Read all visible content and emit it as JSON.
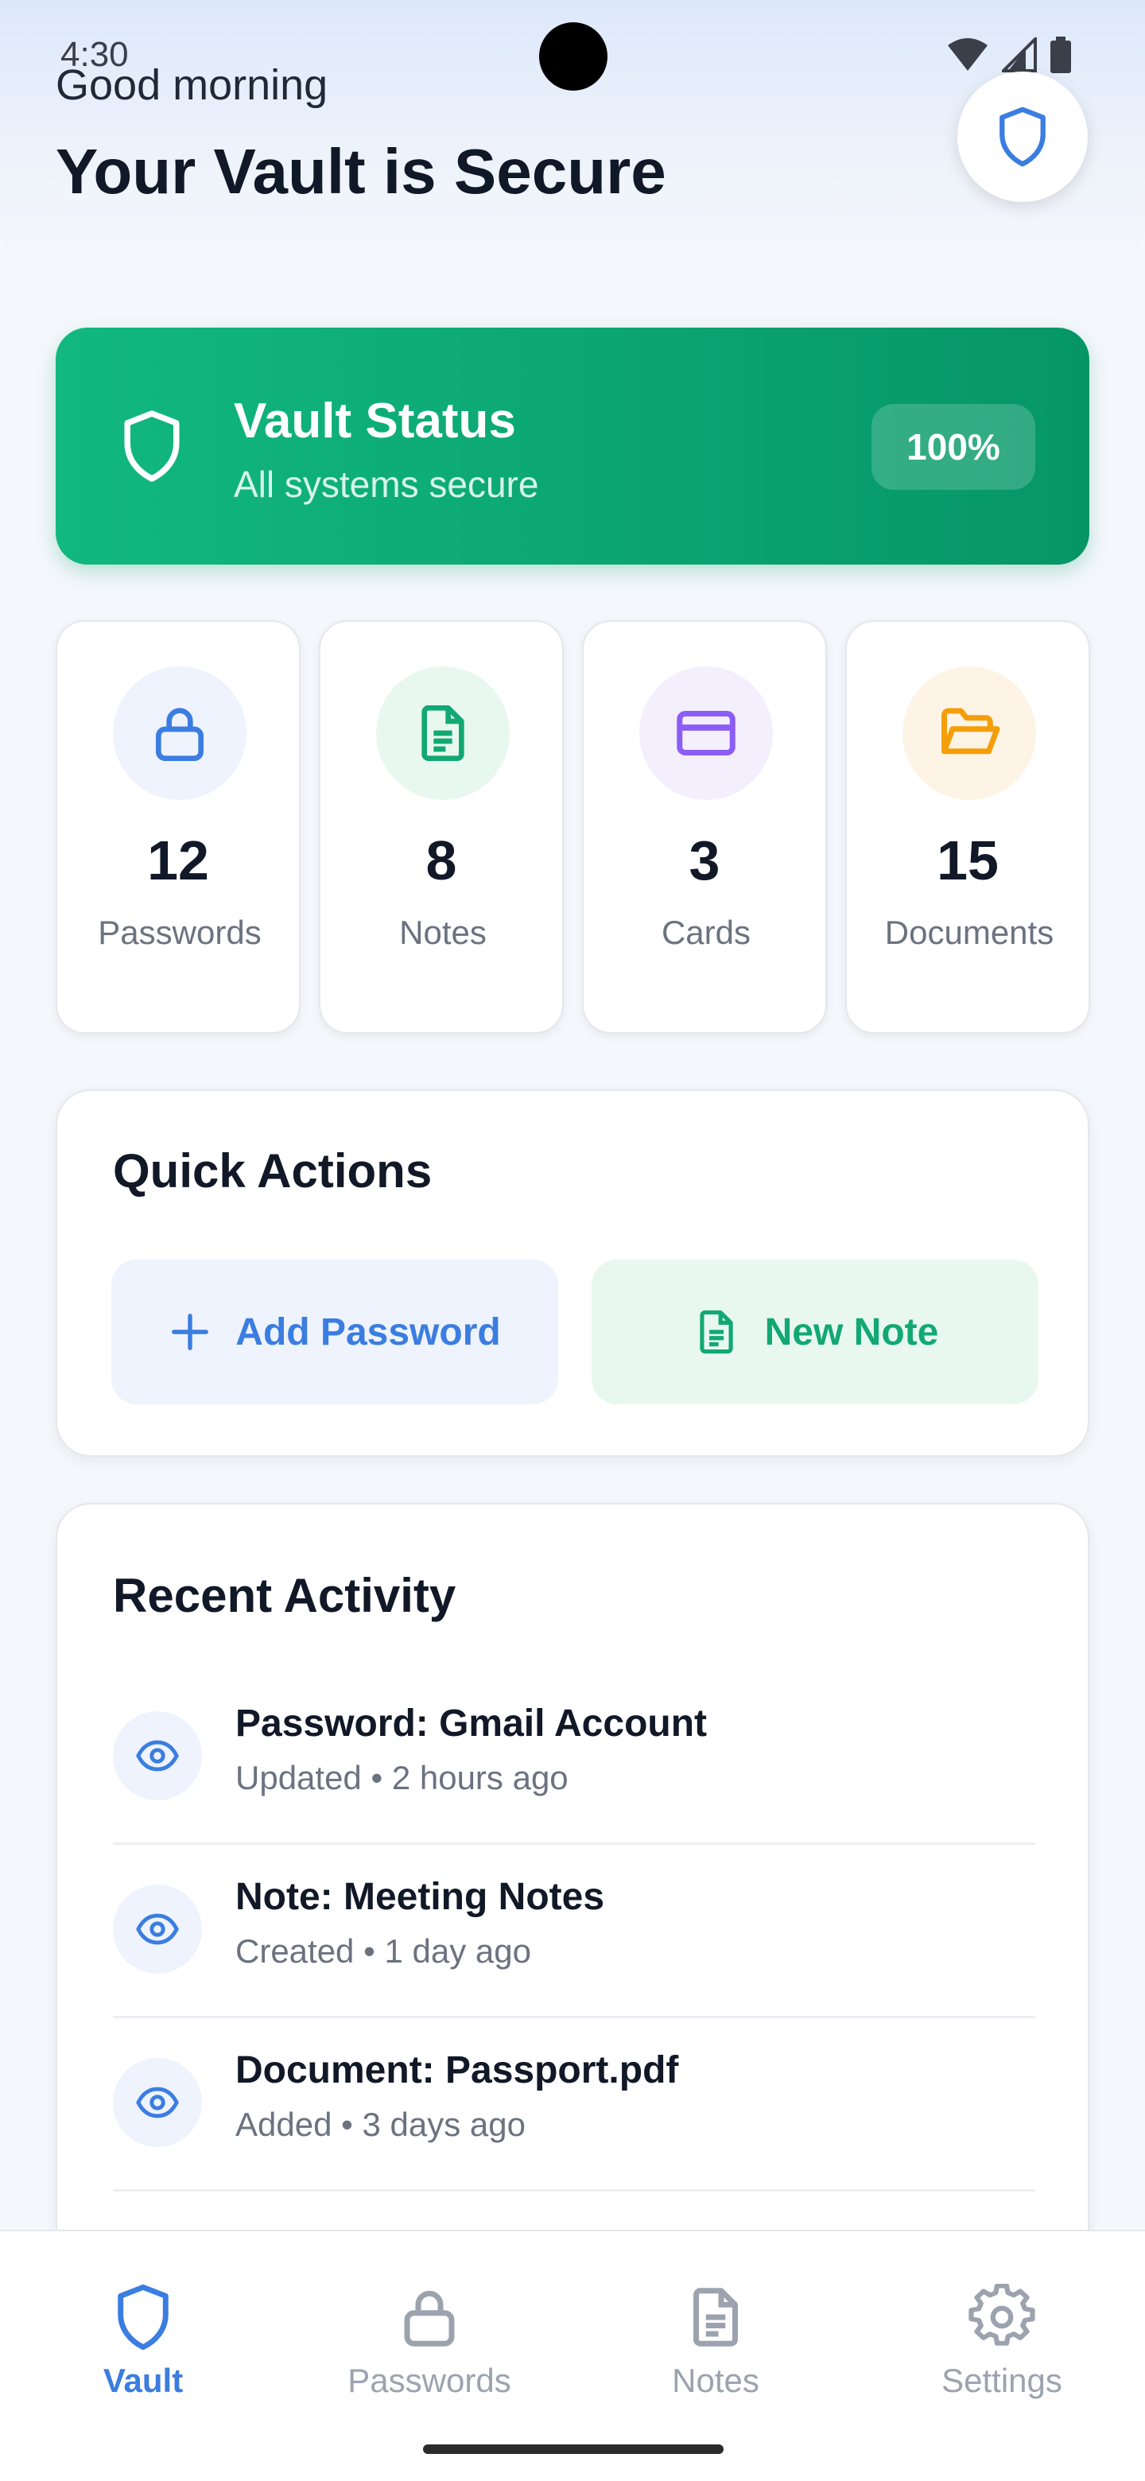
{
  "status_bar": {
    "time": "4:30"
  },
  "header": {
    "greeting": "Good morning",
    "title": "Your Vault is Secure",
    "shield_icon": "shield-icon"
  },
  "vault_status": {
    "title": "Vault Status",
    "subtitle": "All systems secure",
    "percent": "100%",
    "color": "#10b37d"
  },
  "stats": [
    {
      "count": "12",
      "label": "Passwords",
      "icon": "lock-icon",
      "color": "#3b7de0",
      "bg": "#eef3fd"
    },
    {
      "count": "8",
      "label": "Notes",
      "icon": "document-icon",
      "color": "#12a875",
      "bg": "#e8f8f1"
    },
    {
      "count": "3",
      "label": "Cards",
      "icon": "credit-card-icon",
      "color": "#8b5cf6",
      "bg": "#f3effd"
    },
    {
      "count": "15",
      "label": "Documents",
      "icon": "folder-icon",
      "color": "#f59e0b",
      "bg": "#fef4e6"
    }
  ],
  "quick_actions": {
    "title": "Quick Actions",
    "add_password": "Add Password",
    "new_note": "New Note"
  },
  "recent_activity": {
    "title": "Recent Activity",
    "items": [
      {
        "title": "Password: Gmail Account",
        "subtitle": "Updated • 2 hours ago"
      },
      {
        "title": "Note: Meeting Notes",
        "subtitle": "Created • 1 day ago"
      },
      {
        "title": "Document: Passport.pdf",
        "subtitle": "Added • 3 days ago"
      }
    ]
  },
  "bottom_nav": {
    "items": [
      {
        "label": "Vault",
        "icon": "shield-icon",
        "active": true
      },
      {
        "label": "Passwords",
        "icon": "lock-icon",
        "active": false
      },
      {
        "label": "Notes",
        "icon": "document-icon",
        "active": false
      },
      {
        "label": "Settings",
        "icon": "gear-icon",
        "active": false
      }
    ],
    "active_color": "#3b7de0",
    "inactive_color": "#9ca3af"
  }
}
